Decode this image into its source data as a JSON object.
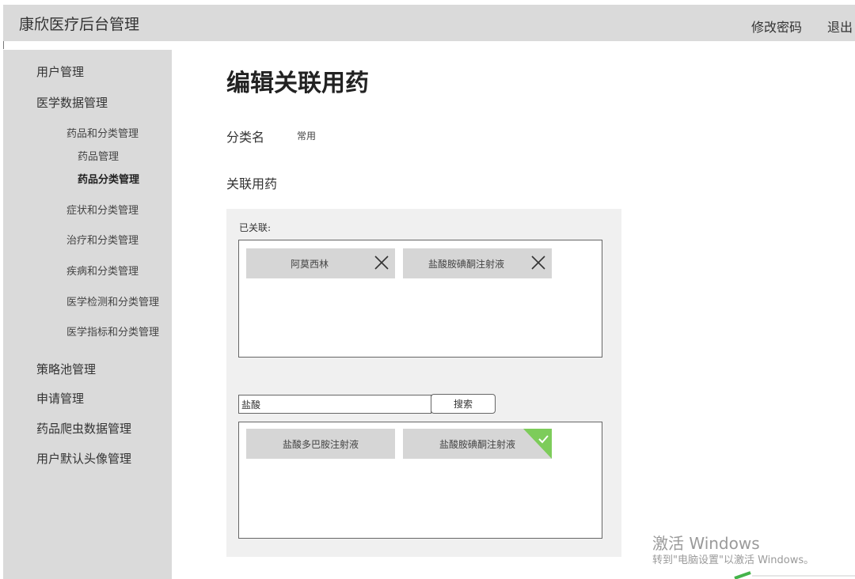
{
  "header": {
    "app_title": "康欣医疗后台管理",
    "change_password": "修改密码",
    "logout": "退出"
  },
  "sidebar": {
    "user_mgmt": "用户管理",
    "medical_data_mgmt": "医学数据管理",
    "drug_category_mgmt": "药品和分类管理",
    "drug_mgmt": "药品管理",
    "drug_classification_mgmt": "药品分类管理",
    "symptom_mgmt": "症状和分类管理",
    "treatment_mgmt": "治疗和分类管理",
    "disease_mgmt": "疾病和分类管理",
    "test_mgmt": "医学检测和分类管理",
    "indicator_mgmt": "医学指标和分类管理",
    "strategy_pool_mgmt": "策略池管理",
    "application_mgmt": "申请管理",
    "crawler_mgmt": "药品爬虫数据管理",
    "avatar_mgmt": "用户默认头像管理"
  },
  "main": {
    "title": "编辑关联用药",
    "category_label": "分类名",
    "category_value": "常用",
    "related_label": "关联用药",
    "linked_caption": "已关联:",
    "linked_items": [
      "阿莫西林",
      "盐酸胺碘酮注射液"
    ],
    "search_value": "盐酸",
    "search_button": "搜索",
    "result_items": [
      "盐酸多巴胺注射液",
      "盐酸胺碘酮注射液"
    ]
  },
  "watermark": {
    "line1": "激活 Windows",
    "line2": "转到\"电脑设置\"以激活 Windows。"
  },
  "colors": {
    "chrome": "#dadada",
    "chip": "#d6d6d6",
    "panel": "#f0f0f0",
    "selected_flag": "#7dcc5a"
  }
}
